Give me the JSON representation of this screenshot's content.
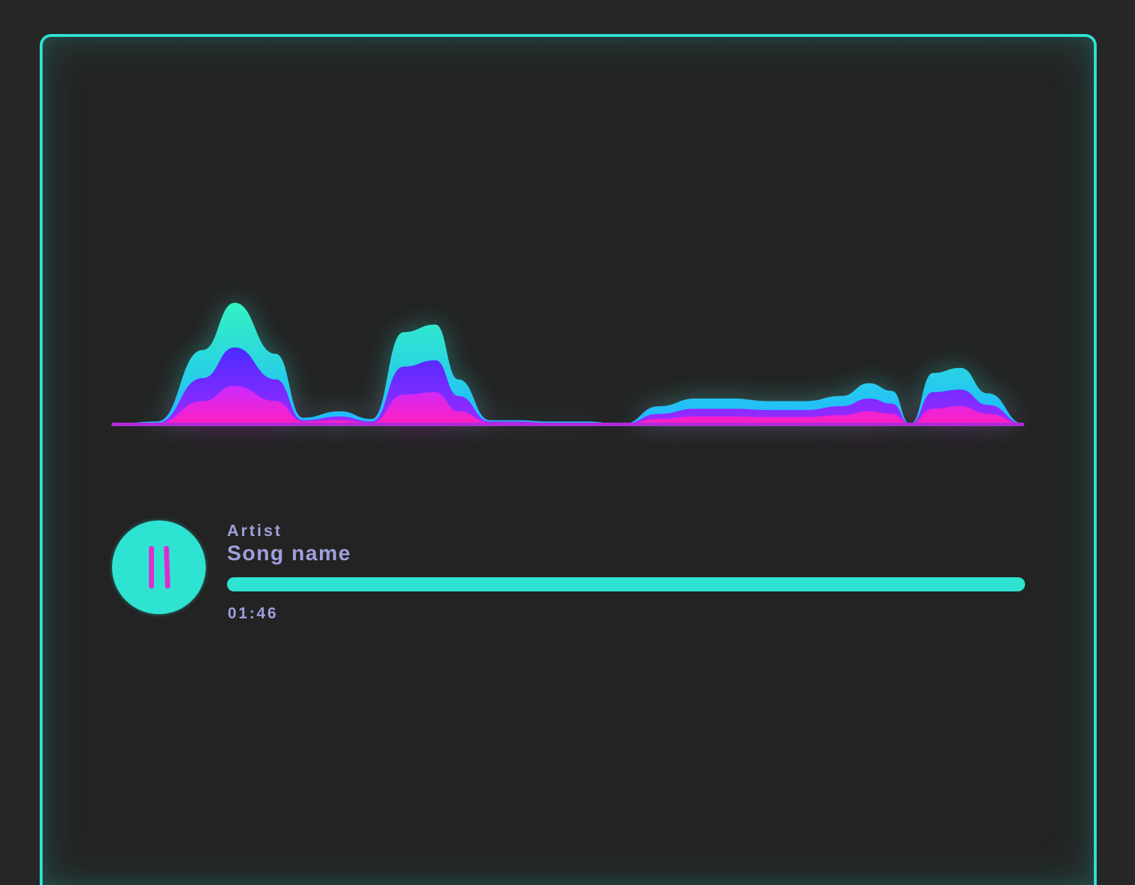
{
  "player": {
    "artist": "Artist",
    "song_name": "Song name",
    "elapsed_time": "01:46",
    "progress": 1.0,
    "state": "playing"
  },
  "controls": {
    "toggle_icon": "pause-icon"
  },
  "colors": {
    "background": "#262626",
    "frame_accent": "#2fe3d2",
    "button_fill": "#2fe3d2",
    "pause_glyph": "#e02bd0",
    "text": "#9ea0dc",
    "wave_top": "#2fe3d2",
    "wave_mid": "#4b2bff",
    "wave_bottom": "#ff1fc0"
  },
  "chart_data": {
    "type": "area",
    "x": [
      0,
      0.05,
      0.1,
      0.135,
      0.18,
      0.21,
      0.25,
      0.285,
      0.32,
      0.355,
      0.38,
      0.415,
      0.445,
      0.48,
      0.52,
      0.56,
      0.6,
      0.64,
      0.68,
      0.72,
      0.76,
      0.8,
      0.83,
      0.855,
      0.875,
      0.9,
      0.93,
      0.96,
      1.0
    ],
    "series": [
      {
        "values": [
          0,
          0.02,
          0.58,
          0.95,
          0.55,
          0.05,
          0.1,
          0.04,
          0.72,
          0.78,
          0.35,
          0.03,
          0.03,
          0.02,
          0.02,
          0.0,
          0.14,
          0.2,
          0.2,
          0.18,
          0.18,
          0.22,
          0.32,
          0.26,
          0.0,
          0.4,
          0.44,
          0.24,
          0.0
        ]
      },
      {
        "values": [
          0,
          0.01,
          0.36,
          0.6,
          0.35,
          0.03,
          0.06,
          0.02,
          0.45,
          0.5,
          0.22,
          0.02,
          0.02,
          0.01,
          0.01,
          0.0,
          0.08,
          0.12,
          0.12,
          0.11,
          0.11,
          0.14,
          0.2,
          0.16,
          0.0,
          0.25,
          0.27,
          0.15,
          0.0
        ]
      },
      {
        "values": [
          0,
          0.005,
          0.18,
          0.3,
          0.18,
          0.02,
          0.03,
          0.01,
          0.23,
          0.25,
          0.1,
          0.01,
          0.01,
          0.005,
          0.005,
          0.0,
          0.04,
          0.06,
          0.06,
          0.055,
          0.055,
          0.07,
          0.1,
          0.08,
          0.0,
          0.12,
          0.14,
          0.08,
          0.0
        ]
      }
    ],
    "ylim": [
      0,
      1
    ]
  }
}
